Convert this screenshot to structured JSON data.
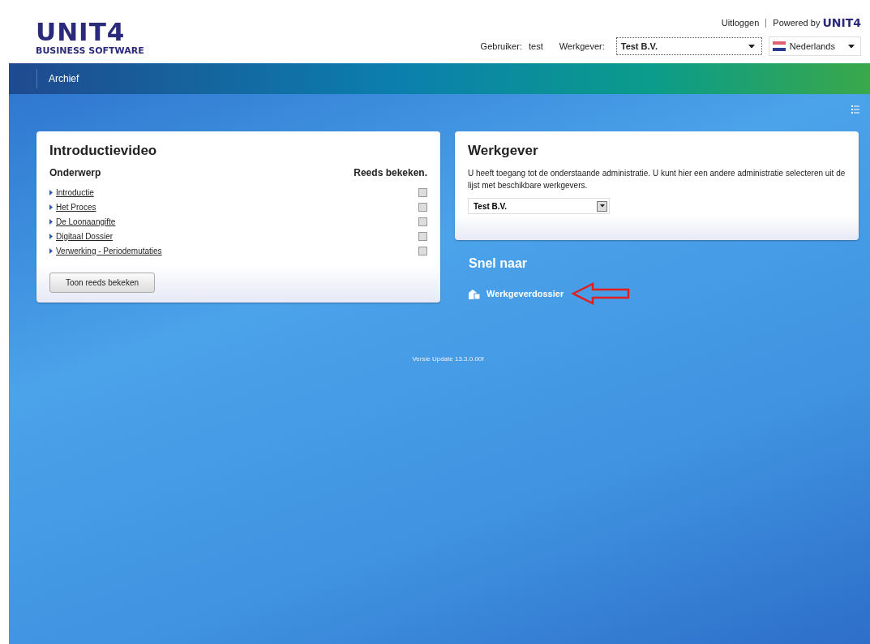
{
  "header": {
    "logo": {
      "mark": "UNIT4",
      "tagline": "BUSINESS SOFTWARE"
    },
    "logout": "Uitloggen",
    "powered_by": "Powered by",
    "powered_logo": "UNIT4",
    "user_label": "Gebruiker:",
    "user": "test",
    "employer_label": "Werkgever:",
    "employer_value": "Test B.V.",
    "language": "Nederlands"
  },
  "nav": {
    "items": [
      {
        "label": "Archief",
        "selected": false
      }
    ]
  },
  "intro": {
    "title": "Introductievideo",
    "col_subject": "Onderwerp",
    "col_seen": "Reeds bekeken.",
    "videos": [
      {
        "label": "Introductie",
        "checked": false
      },
      {
        "label": "Het Proces",
        "checked": false
      },
      {
        "label": "De Loonaangifte",
        "checked": false
      },
      {
        "label": "Digitaal Dossier",
        "checked": false
      },
      {
        "label": "Verwerking - Periodemutaties",
        "checked": false
      }
    ],
    "button": "Toon reeds bekeken"
  },
  "employer": {
    "title": "Werkgever",
    "text": "U heeft toegang tot de onderstaande administratie. U kunt hier een andere administratie selecteren uit de lijst met beschikbare werkgevers.",
    "select_value": "Test B.V."
  },
  "quick": {
    "title": "Snel naar",
    "links": [
      {
        "label": "Werkgeverdossier",
        "annotated": true
      }
    ]
  },
  "version": "Versie Update 13.3.0.00f"
}
